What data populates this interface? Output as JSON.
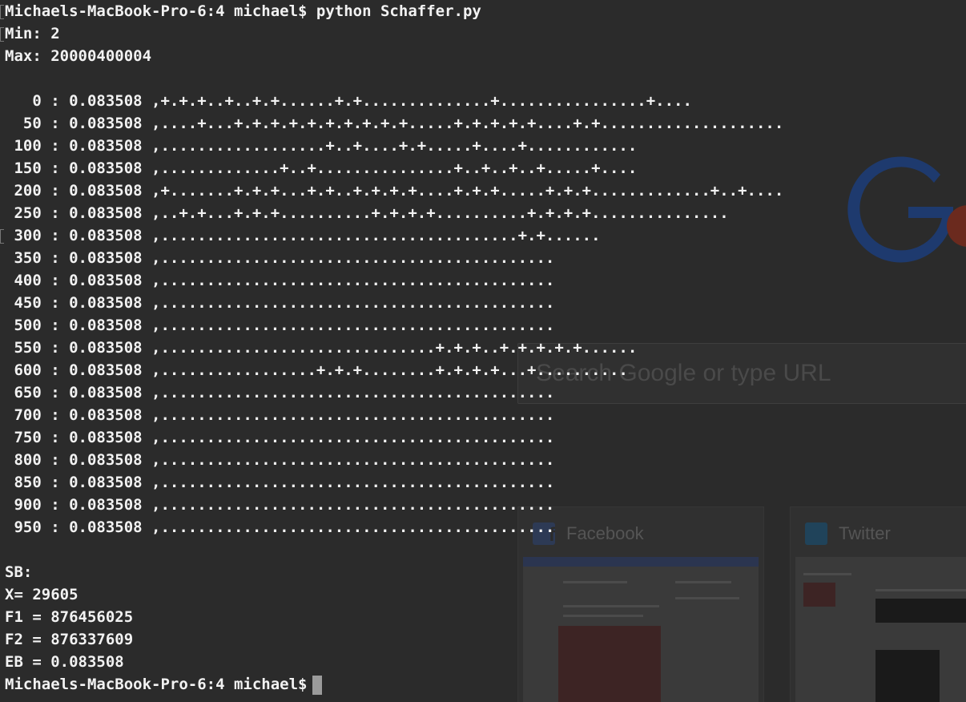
{
  "terminal": {
    "prompt_command": "Michaels-MacBook-Pro-6:4 michael$ python Schaffer.py",
    "min_line": "Min: 2",
    "max_line": "Max: 20000400004",
    "rows": [
      "   0 : 0.083508 ,+.+.+..+..+.+......+.+..............+................+....",
      "  50 : 0.083508 ,....+...+.+.+.+.+.+.+.+.+.+.....+.+.+.+.+....+.+....................",
      " 100 : 0.083508 ,..................+..+....+.+.....+....+............",
      " 150 : 0.083508 ,.............+..+...............+..+..+..+.....+....",
      " 200 : 0.083508 ,+.......+.+.+...+.+..+.+.+.+....+.+.+.....+.+.+.............+..+....",
      " 250 : 0.083508 ,..+.+...+.+.+..........+.+.+.+..........+.+.+.+...............",
      " 300 : 0.083508 ,.......................................+.+......",
      " 350 : 0.083508 ,...........................................",
      " 400 : 0.083508 ,...........................................",
      " 450 : 0.083508 ,...........................................",
      " 500 : 0.083508 ,...........................................",
      " 550 : 0.083508 ,..............................+.+.+..+.+.+.+.+......",
      " 600 : 0.083508 ,.................+.+.+........+.+.+.+...+..........",
      " 650 : 0.083508 ,...........................................",
      " 700 : 0.083508 ,...........................................",
      " 750 : 0.083508 ,...........................................",
      " 800 : 0.083508 ,...........................................",
      " 850 : 0.083508 ,...........................................",
      " 900 : 0.083508 ,...........................................",
      " 950 : 0.083508 ,..........................................."
    ],
    "sb_label": "SB:",
    "x_line": "X= 29605",
    "f1_line": "F1 = 876456025",
    "f2_line": "F2 = 876337609",
    "eb_line": "EB = 0.083508",
    "final_prompt": "Michaels-MacBook-Pro-6:4 michael$"
  },
  "background_browser": {
    "search_placeholder": "Search Google or type URL",
    "tiles": [
      {
        "label": "Facebook",
        "icon": "facebook-icon"
      },
      {
        "label": "Twitter",
        "icon": "twitter-icon"
      }
    ]
  },
  "colors": {
    "terminal_bg": "#2b2b2b",
    "terminal_text": "#f2f2f2",
    "cursor": "#9b9b9b",
    "google_blue": "#1e3a6e",
    "google_red": "#6b2a1e"
  }
}
